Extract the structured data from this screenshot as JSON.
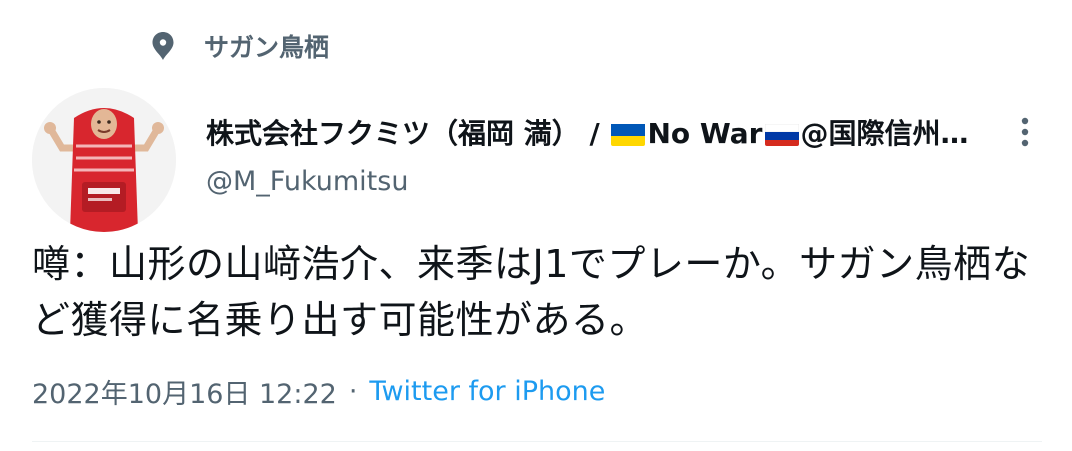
{
  "topic": {
    "icon": "topic-pin-icon",
    "label": "サガン鳥栖"
  },
  "author": {
    "avatar": "author-avatar",
    "name_prefix": "株式会社フクミツ（福岡 満） / ",
    "flag_ukraine": "ukraine-flag-icon",
    "name_middle": "No War",
    "flag_russia": "russia-flag-icon",
    "name_suffix": "@国際信州学…",
    "handle": "@M_Fukumitsu",
    "more_icon": "more-vertical-icon"
  },
  "tweet": {
    "text": "噂：山形の山﨑浩介、来季はJ1でプレーか。サガン鳥栖など獲得に名乗り出す可能性がある。",
    "timestamp": "2022年10月16日 12:22",
    "separator": "·",
    "source": "Twitter for iPhone"
  },
  "colors": {
    "text_primary": "#0f1419",
    "text_secondary": "#536471",
    "link": "#1d9bf0",
    "divider": "#eff3f4"
  }
}
